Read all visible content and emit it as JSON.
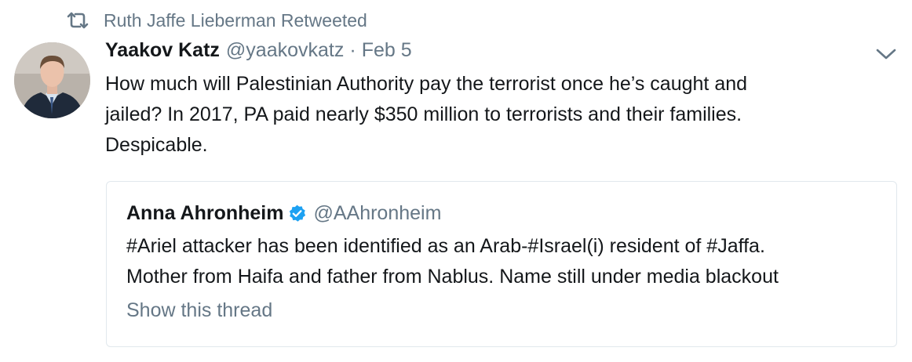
{
  "retweet": {
    "icon": "retweet-icon",
    "label": "Ruth Jaffe Lieberman Retweeted"
  },
  "tweet": {
    "author_name": "Yaakov Katz",
    "author_handle": "@yaakovkatz",
    "separator": "·",
    "date": "Feb 5",
    "text_lines": [
      "How much will Palestinian Authority pay the terrorist once he’s caught and",
      "jailed? In 2017, PA paid nearly $350 million to terrorists and their families.",
      "Despicable."
    ],
    "menu_icon": "chevron-down-icon"
  },
  "quoted": {
    "author_name": "Anna Ahronheim",
    "verified_icon": "verified-badge-icon",
    "author_handle": "@AAhronheim",
    "text_lines": [
      "#Ariel attacker has been identified as an Arab-#Israel(i) resident of #Jaffa.",
      "Mother from Haifa and father from Nablus. Name still under media blackout"
    ],
    "show_thread": "Show this thread"
  },
  "colors": {
    "text_primary": "#14171a",
    "text_secondary": "#657786",
    "verified_blue": "#1da1f2",
    "card_border": "#e1e8ed"
  }
}
